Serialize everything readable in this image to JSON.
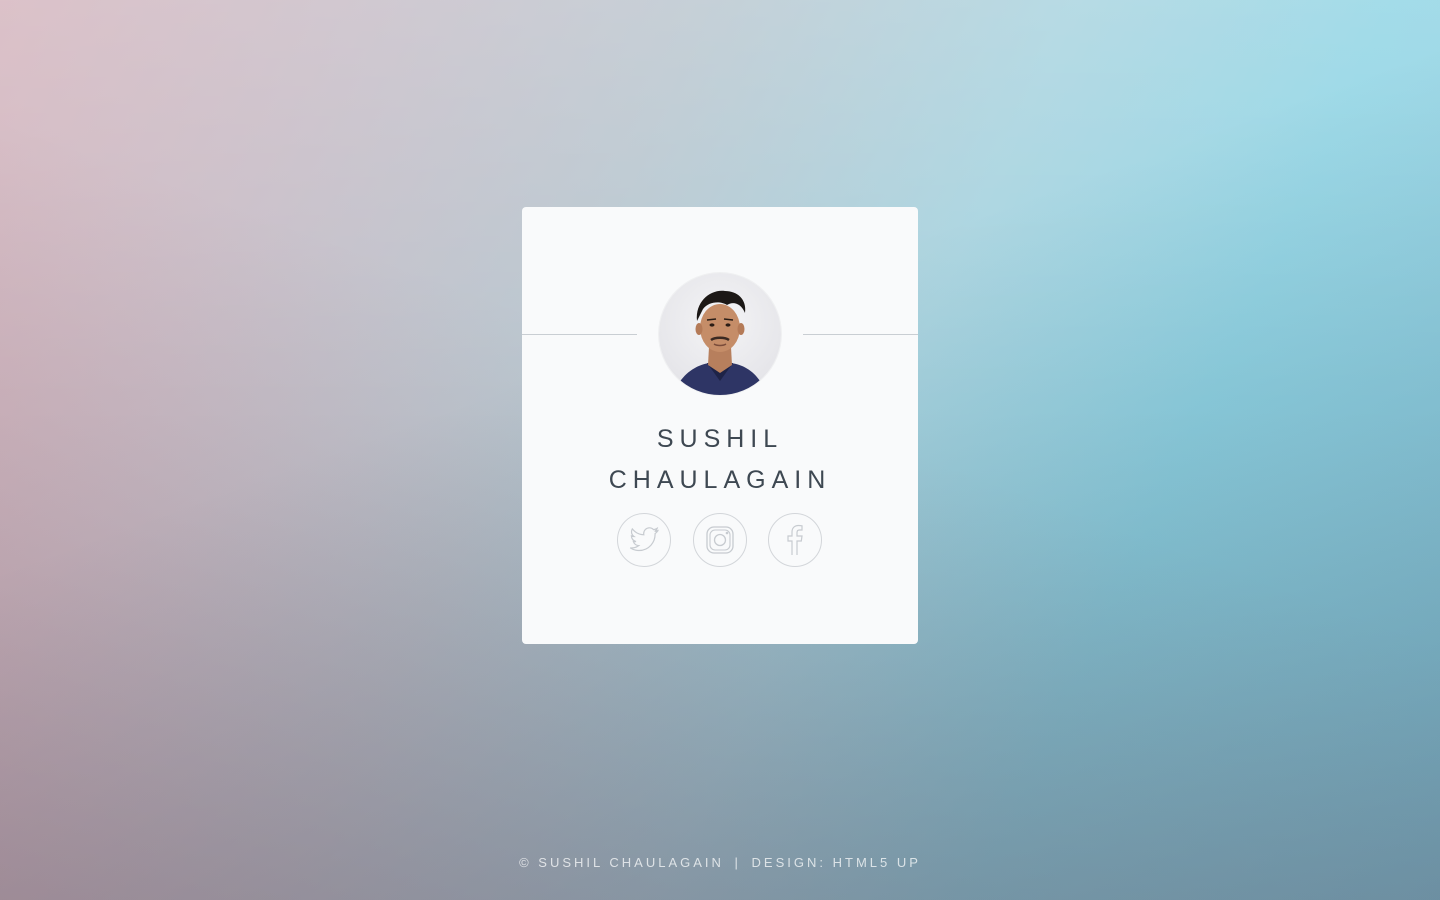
{
  "profile": {
    "first_name": "SUSHIL",
    "last_name": "CHAULAGAIN",
    "avatar_alt": "profile-photo"
  },
  "socials": [
    {
      "name": "twitter",
      "icon": "twitter-icon"
    },
    {
      "name": "instagram",
      "icon": "instagram-icon"
    },
    {
      "name": "facebook",
      "icon": "facebook-icon"
    }
  ],
  "footer": {
    "copyright": "© SUSHIL CHAULAGAIN",
    "separator": "|",
    "design_credit": "DESIGN: HTML5 UP"
  },
  "colors": {
    "card_bg": "#f9fafb",
    "text": "#3e4852",
    "rule": "#c9ced3",
    "icon_stroke": "#c7cbd0"
  }
}
